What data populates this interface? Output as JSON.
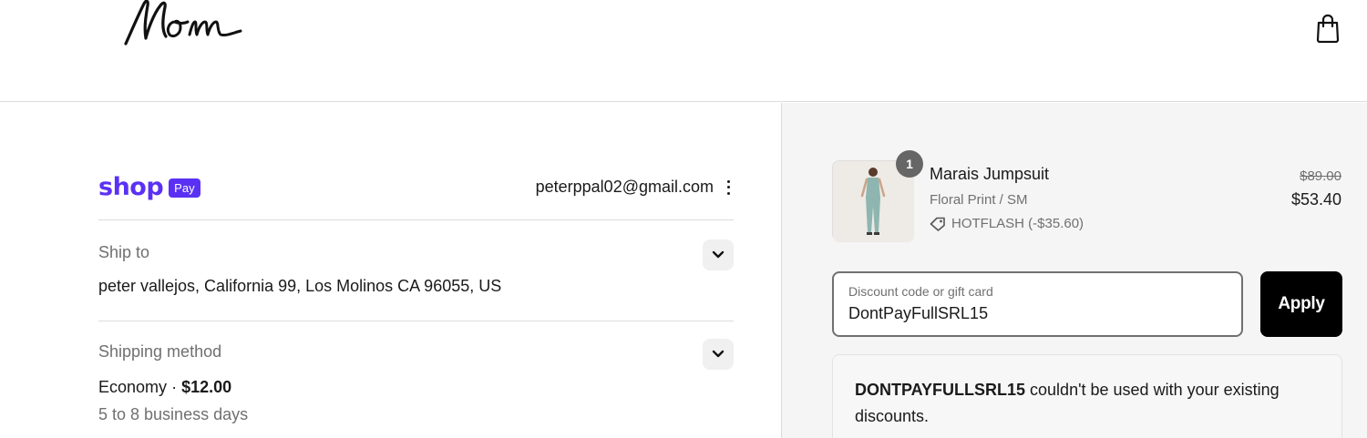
{
  "header": {
    "logo_text": "Nom",
    "cart_icon": "shopping-bag-icon"
  },
  "express": {
    "brand_word": "shop",
    "brand_badge": "Pay",
    "email": "peterppal02@gmail.com",
    "menu_icon": "kebab-menu-icon"
  },
  "ship_to": {
    "label": "Ship to",
    "value": "peter vallejos, California 99, Los Molinos CA 96055, US",
    "toggle_icon": "chevron-down-icon"
  },
  "shipping_method": {
    "label": "Shipping method",
    "name": "Economy",
    "separator": "·",
    "price": "$12.00",
    "delivery": "5 to 8 business days",
    "toggle_icon": "chevron-down-icon"
  },
  "order_summary": {
    "item": {
      "quantity": "1",
      "name": "Marais Jumpsuit",
      "variant": "Floral Print / SM",
      "discount_label": "HOTFLASH (-$35.60)",
      "discount_icon": "tag-icon",
      "price_original": "$89.00",
      "price_final": "$53.40"
    },
    "discount": {
      "placeholder": "Discount code or gift card",
      "value": "DontPayFullSRL15",
      "apply_label": "Apply"
    },
    "error": {
      "code": "DONTPAYFULLSRL15",
      "message": " couldn't be used with your existing discounts."
    }
  },
  "colors": {
    "shop_pay_purple": "#5a31f4",
    "summary_bg": "#f5f5f5",
    "apply_bg": "#000000"
  }
}
